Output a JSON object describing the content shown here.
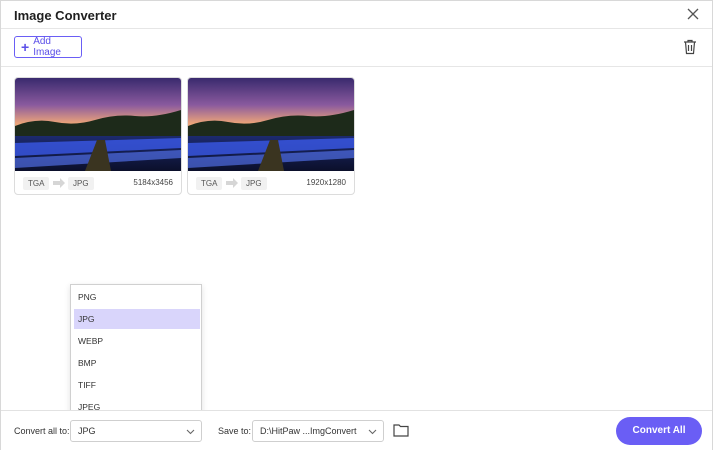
{
  "window": {
    "title": "Image Converter"
  },
  "toolbar": {
    "add_label": "Add Image"
  },
  "images": [
    {
      "from": "TGA",
      "to": "JPG",
      "resolution": "5184x3456"
    },
    {
      "from": "TGA",
      "to": "JPG",
      "resolution": "1920x1280"
    }
  ],
  "format_menu": {
    "options": [
      "PNG",
      "JPG",
      "WEBP",
      "BMP",
      "TIFF",
      "JPEG"
    ],
    "selected": "JPG"
  },
  "bottom": {
    "convert_all_label": "Convert all to:",
    "convert_all_value": "JPG",
    "save_to_label": "Save to:",
    "save_to_value": "D:\\HitPaw ...ImgConvert",
    "convert_button": "Convert All"
  },
  "colors": {
    "accent": "#6a5ef5",
    "selected_bg": "#d9d5fb"
  },
  "icons": [
    "close-icon",
    "plus-icon",
    "trash-icon",
    "arrow-right-icon",
    "chevron-down-icon",
    "folder-icon"
  ]
}
